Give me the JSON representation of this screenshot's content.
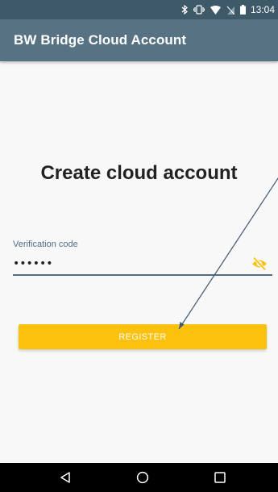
{
  "status_bar": {
    "time": "13:04",
    "icons": [
      "bluetooth-icon",
      "vibrate-icon",
      "wifi-icon",
      "no-sim-icon",
      "battery-icon"
    ]
  },
  "app_bar": {
    "title": "BW Bridge Cloud Account"
  },
  "main": {
    "heading": "Create cloud account",
    "verification_field": {
      "label": "Verification code",
      "value": "••••••",
      "toggle_icon": "eye-off-icon"
    },
    "register_button": {
      "label": "REGISTER"
    }
  },
  "nav_bar": {
    "buttons": [
      "back-icon",
      "home-icon",
      "recents-icon"
    ]
  },
  "colors": {
    "status_bar": "#3e5a69",
    "app_bar": "#577282",
    "accent": "#fbc10d",
    "field": "#4f6e84",
    "background": "#f8f8f8",
    "annotation": "#3c5a75"
  }
}
